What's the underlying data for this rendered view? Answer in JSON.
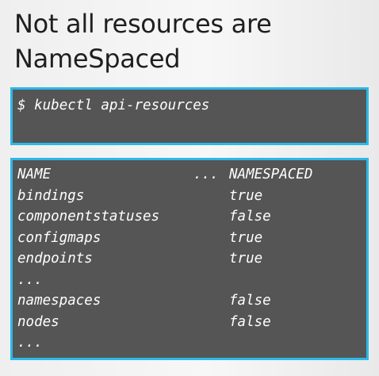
{
  "slide": {
    "title_line1": "Not all resources are",
    "title_line2": "NameSpaced"
  },
  "command_terminal": {
    "prompt": "$",
    "command": "kubectl api-resources"
  },
  "output_terminal": {
    "header": {
      "name": "NAME",
      "ellipsis": "...",
      "namespaced": "NAMESPACED"
    },
    "rows": [
      {
        "name": "bindings",
        "namespaced": "true"
      },
      {
        "name": "componentstatuses",
        "namespaced": "false"
      },
      {
        "name": "configmaps",
        "namespaced": "true"
      },
      {
        "name": "endpoints",
        "namespaced": "true"
      },
      {
        "name": "...",
        "namespaced": ""
      },
      {
        "name": "namespaces",
        "namespaced": "false"
      },
      {
        "name": "nodes",
        "namespaced": "false"
      },
      {
        "name": "...",
        "namespaced": ""
      }
    ]
  },
  "colors": {
    "terminal_bg": "#555555",
    "terminal_border": "#2bb8e8",
    "terminal_text": "#ffffff",
    "title_text": "#1f1f1f"
  }
}
